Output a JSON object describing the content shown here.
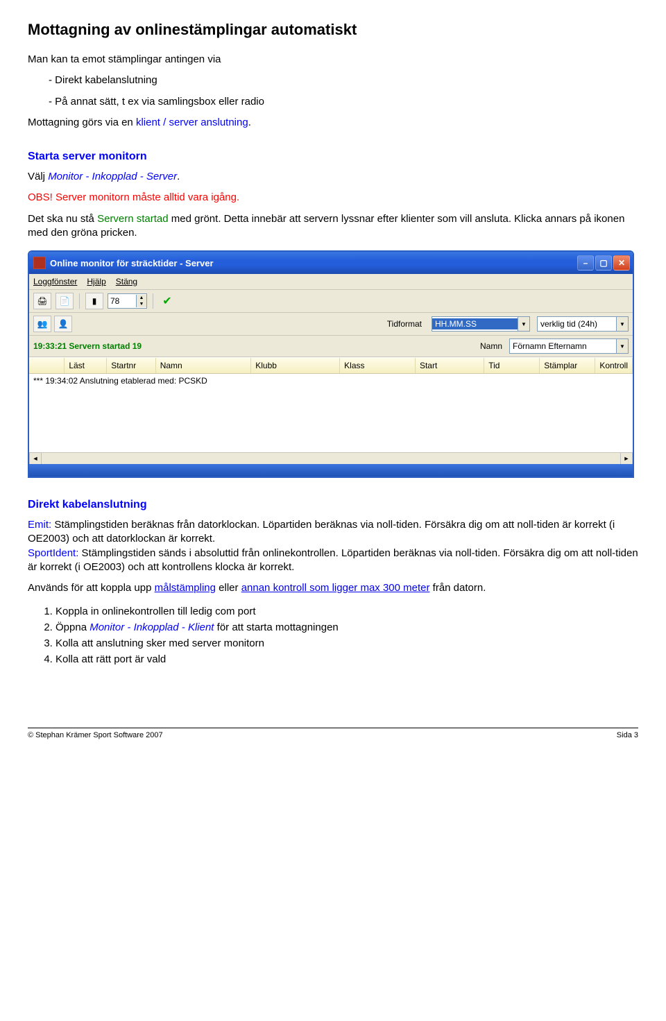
{
  "doc": {
    "title": "Mottagning av onlinestämplingar automatiskt",
    "intro": "Man kan ta emot stämplingar antingen via",
    "bullet1": "- Direkt kabelanslutning",
    "bullet2": "- På annat sätt, t ex via samlingsbox eller radio",
    "intro2a": "Mottagning görs via en ",
    "intro2b": "klient / server anslutning",
    "intro2c": ".",
    "h2a": "Starta server monitorn",
    "p_valj": "Välj ",
    "p_menu": "Monitor - Inkopplad - Server",
    "p_after": ".",
    "obs": "OBS! Server monitorn måste alltid vara igång.",
    "p3a": "Det ska nu stå ",
    "p3b": "Servern startad",
    "p3c": " med grönt. Detta innebär att servern lyssnar efter klienter som vill ansluta. Klicka annars på ikonen med den gröna pricken.",
    "h2b": "Direkt kabelanslutning",
    "emit_lbl": "Emit:",
    "emit_txt": " Stämplingstiden beräknas från datorklockan. Löpartiden beräknas via noll-tiden. Försäkra dig om att noll-tiden är korrekt (i OE2003) och att datorklockan är korrekt.",
    "si_lbl": "SportIdent:",
    "si_txt": " Stämplingstiden sänds i absoluttid från onlinekontrollen. Löpartiden beräknas via noll-tiden. Försäkra dig om att noll-tiden är korrekt (i OE2003) och att kontrollens klocka är korrekt.",
    "p5a": "Används för att koppla upp ",
    "p5link1": "målstämpling",
    "p5mid": " eller ",
    "p5link2": "annan kontroll som ligger max 300 meter",
    "p5end": " från datorn.",
    "li1": "Koppla in onlinekontrollen till ledig com port",
    "li2a": "Öppna ",
    "li2b": "Monitor - Inkopplad - Klient",
    "li2c": " för att starta mottagningen",
    "li3": "Kolla att anslutning sker med server monitorn",
    "li4": "Kolla att rätt port är vald"
  },
  "app": {
    "title": "Online monitor för sträcktider - Server",
    "menu": {
      "logg": "Loggfönster",
      "hjalp": "Hjälp",
      "stang": "Stäng"
    },
    "nud": "78",
    "tidformat_lbl": "Tidformat",
    "tidformat_val": "HH.MM.SS",
    "realtid": "verklig tid (24h)",
    "status": "19:33:21 Servern startad 19",
    "namn_lbl": "Namn",
    "namn_val": "Förnamn Efternamn",
    "cols": {
      "last": "Läst",
      "startnr": "Startnr",
      "namn": "Namn",
      "klubb": "Klubb",
      "klass": "Klass",
      "start": "Start",
      "tid": "Tid",
      "stamplar": "Stämplar",
      "kontroll": "Kontroll"
    },
    "logline": "*** 19:34:02 Anslutning etablerad med: PCSKD"
  },
  "footer": {
    "left": "© Stephan Krämer Sport Software 2007",
    "right": "Sida 3"
  }
}
